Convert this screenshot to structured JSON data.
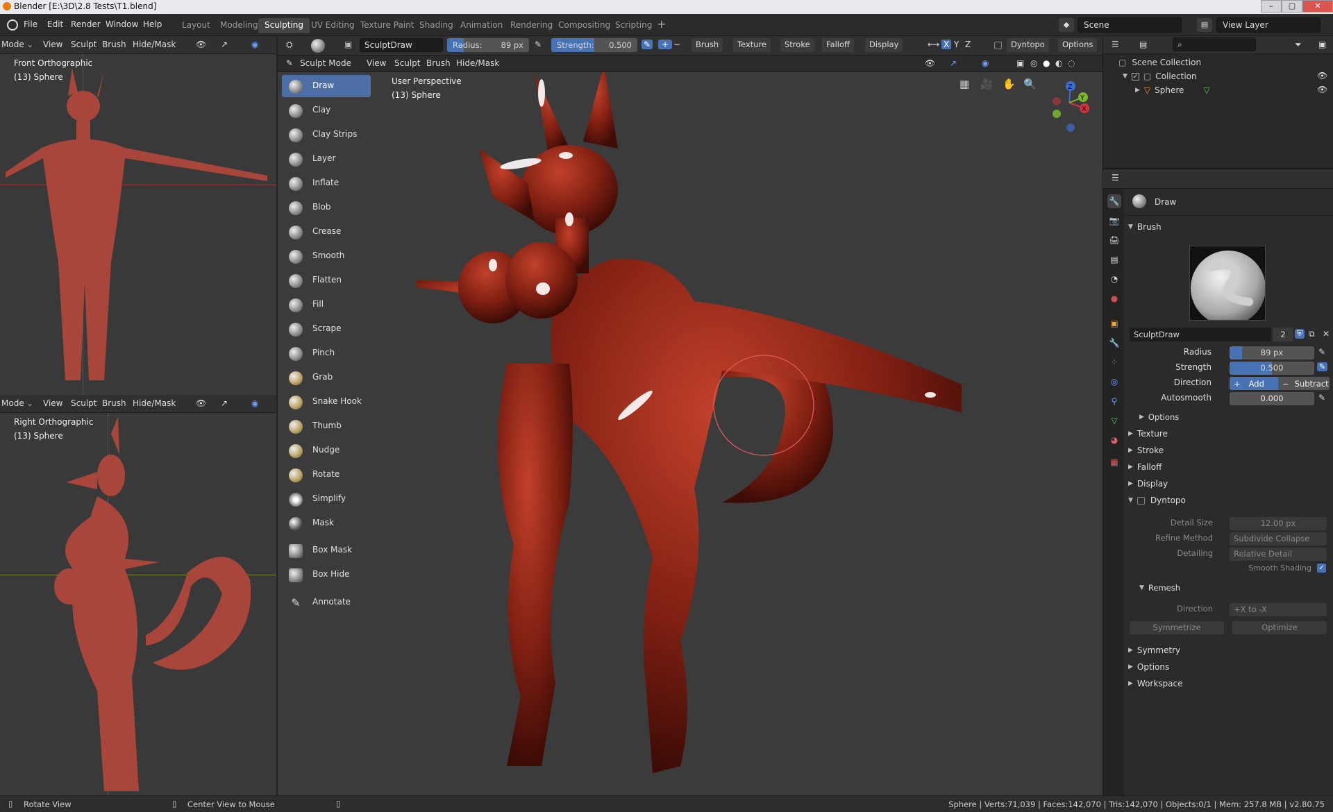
{
  "window": {
    "title": "Blender [E:\\3D\\2.8 Tests\\T1.blend]"
  },
  "menu": {
    "items": [
      "File",
      "Edit",
      "Render",
      "Window",
      "Help"
    ]
  },
  "workspaces": [
    "Layout",
    "Modeling",
    "Sculpting",
    "UV Editing",
    "Texture Paint",
    "Shading",
    "Animation",
    "Rendering",
    "Compositing",
    "Scripting"
  ],
  "workspace_add": "+",
  "scene": {
    "name": "Scene",
    "view_layer": "View Layer"
  },
  "small_viewports": [
    {
      "mode": "Mode",
      "menus": [
        "View",
        "Sculpt",
        "Brush",
        "Hide/Mask"
      ],
      "view": "Front Orthographic",
      "object": "(13) Sphere"
    },
    {
      "mode": "Mode",
      "menus": [
        "View",
        "Sculpt",
        "Brush",
        "Hide/Mask"
      ],
      "view": "Right Orthographic",
      "object": "(13) Sphere"
    }
  ],
  "tool_header": {
    "brush_name": "SculptDraw",
    "radius_label": "Radius:",
    "radius_value": "89 px",
    "strength_label": "Strength:",
    "strength_value": "0.500",
    "plus": "+",
    "minus": "−",
    "dropdowns": [
      "Brush",
      "Texture",
      "Stroke",
      "Falloff",
      "Display"
    ],
    "axes": [
      "X",
      "Y",
      "Z"
    ],
    "dyntopo": "Dyntopo",
    "options": "Options"
  },
  "main_viewport": {
    "mode": "Sculpt Mode",
    "menus": [
      "View",
      "Sculpt",
      "Brush",
      "Hide/Mask"
    ],
    "view": "User Perspective",
    "object": "(13) Sphere"
  },
  "tools": [
    "Draw",
    "Clay",
    "Clay Strips",
    "Layer",
    "Inflate",
    "Blob",
    "Crease",
    "Smooth",
    "Flatten",
    "Fill",
    "Scrape",
    "Pinch",
    "Grab",
    "Snake Hook",
    "Thumb",
    "Nudge",
    "Rotate",
    "Simplify",
    "Mask",
    "Box Mask",
    "Box Hide",
    "Annotate"
  ],
  "active_tool": "Draw",
  "gizmo": {
    "x": "X",
    "y": "Y",
    "z": "Z"
  },
  "outliner": {
    "scene_collection": "Scene Collection",
    "collection": "Collection",
    "object": "Sphere"
  },
  "properties": {
    "tool_name": "Draw",
    "brush_panel": "Brush",
    "brush_datablock": "SculptDraw",
    "brush_users": "2",
    "radius_label": "Radius",
    "radius_value": "89 px",
    "strength_label": "Strength",
    "strength_value": "0.500",
    "direction_label": "Direction",
    "direction_add": "Add",
    "direction_subtract": "Subtract",
    "autosmooth_label": "Autosmooth",
    "autosmooth_value": "0.000",
    "options": "Options",
    "panels": [
      "Texture",
      "Stroke",
      "Falloff",
      "Display"
    ],
    "dyntopo": "Dyntopo",
    "detail_size_label": "Detail Size",
    "detail_size_value": "12.00 px",
    "refine_label": "Refine Method",
    "refine_value": "Subdivide Collapse",
    "detailing_label": "Detailing",
    "detailing_value": "Relative Detail",
    "smooth_shading": "Smooth Shading",
    "remesh": "Remesh",
    "remesh_direction_label": "Direction",
    "remesh_direction_value": "+X to -X",
    "symmetrize": "Symmetrize",
    "optimize": "Optimize",
    "bottom_panels": [
      "Symmetry",
      "Options",
      "Workspace"
    ]
  },
  "status": {
    "left1": "Rotate View",
    "left2": "Center View to Mouse",
    "right": "Sphere | Verts:71,039 | Faces:142,070 | Tris:142,070 | Objects:0/1 | Mem: 257.8 MB | v2.80.75"
  },
  "colors": {
    "accent": "#4772b3",
    "model": "#8b2a1a",
    "viewport_bg": "#393939"
  }
}
